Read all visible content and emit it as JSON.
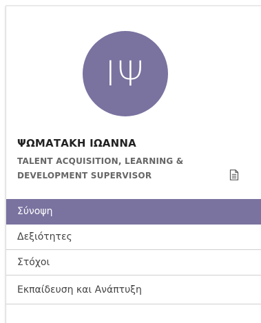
{
  "profile": {
    "avatar_initials": "ΙΨ",
    "name": "ΨΩΜΑΤΑΚΗ ΙΩΑΝΝΑ",
    "job_title_line1": "TALENT ACQUISITION, LEARNING &",
    "job_title_line2": "DEVELOPMENT SUPERVISOR"
  },
  "icons": {
    "document": "document-icon"
  },
  "colors": {
    "accent": "#7a729f"
  },
  "nav": {
    "items": [
      {
        "label": "Σύνοψη",
        "active": true
      },
      {
        "label": "Δεξιότητες",
        "active": false
      },
      {
        "label": "Στόχοι",
        "active": false
      },
      {
        "label": "Εκπαίδευση και Ανάπτυξη",
        "active": false
      }
    ]
  }
}
